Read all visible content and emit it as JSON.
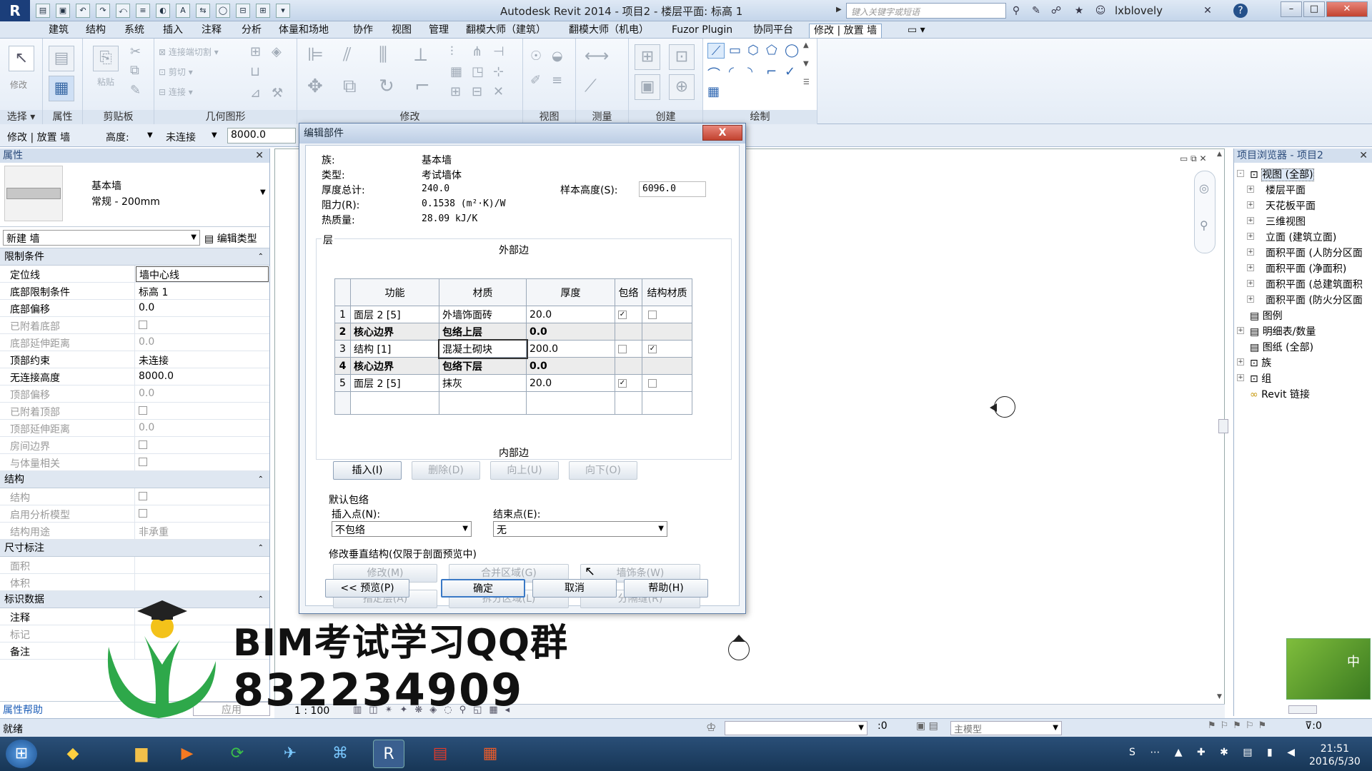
{
  "title": {
    "app": "Autodesk Revit 2014 -    项目2 - 楼层平面: 标高 1",
    "search_placeholder": "键入关键字或短语",
    "user": "lxblovely",
    "help": "?"
  },
  "quick_access": [
    "▤",
    "▣",
    "↶",
    "↷",
    "⤺",
    "≡",
    "◐",
    "A",
    "⇆",
    "◯",
    "⊟",
    "⊞",
    "▾"
  ],
  "menu": [
    "建筑",
    "结构",
    "系统",
    "插入",
    "注释",
    "分析",
    "体量和场地",
    "协作",
    "视图",
    "管理",
    "翻模大师（建筑）",
    "翻模大师（机电）",
    "Fuzor Plugin",
    "协同平台",
    "修改 | 放置 墙",
    "▭ ▾"
  ],
  "ribbon": {
    "groups": [
      "选择 ▾",
      "属性",
      "剪贴板",
      "几何图形",
      "修改",
      "视图",
      "测量",
      "创建",
      "绘制"
    ],
    "modify_label": "修改",
    "paste_label": "粘贴",
    "geometry_items": [
      "连接端切割 ▾",
      "剪切 ▾",
      "连接 ▾"
    ]
  },
  "options_bar": {
    "context": "修改 | 放置 墙",
    "height_label": "高度:",
    "height_mode": "未连接",
    "height_value": "8000.0"
  },
  "properties": {
    "title": "属性",
    "type_name": "基本墙",
    "type_sub": "常规 - 200mm",
    "instance_selector": "新建 墙",
    "edit_type": "编辑类型",
    "sections": [
      {
        "name": "限制条件",
        "rows": [
          {
            "k": "定位线",
            "v": "墙中心线",
            "dis": false
          },
          {
            "k": "底部限制条件",
            "v": "标高 1",
            "dis": false
          },
          {
            "k": "底部偏移",
            "v": "0.0",
            "dis": false
          },
          {
            "k": "已附着底部",
            "v": "",
            "cb": true,
            "dis": true
          },
          {
            "k": "底部延伸距离",
            "v": "0.0",
            "dis": true
          },
          {
            "k": "顶部约束",
            "v": "未连接",
            "dis": false
          },
          {
            "k": "无连接高度",
            "v": "8000.0",
            "dis": false
          },
          {
            "k": "顶部偏移",
            "v": "0.0",
            "dis": true
          },
          {
            "k": "已附着顶部",
            "v": "",
            "cb": true,
            "dis": true
          },
          {
            "k": "顶部延伸距离",
            "v": "0.0",
            "dis": true
          },
          {
            "k": "房间边界",
            "v": "",
            "cb": true,
            "dis": true
          },
          {
            "k": "与体量相关",
            "v": "",
            "cb": true,
            "dis": true
          }
        ]
      },
      {
        "name": "结构",
        "rows": [
          {
            "k": "结构",
            "v": "",
            "cb": true,
            "dis": true
          },
          {
            "k": "启用分析模型",
            "v": "",
            "cb": true,
            "dis": true
          },
          {
            "k": "结构用途",
            "v": "非承重",
            "dis": true
          }
        ]
      },
      {
        "name": "尺寸标注",
        "rows": [
          {
            "k": "面积",
            "v": "",
            "dis": true
          },
          {
            "k": "体积",
            "v": "",
            "dis": true
          }
        ]
      },
      {
        "name": "标识数据",
        "rows": [
          {
            "k": "注释",
            "v": "",
            "dis": false
          },
          {
            "k": "标记",
            "v": "",
            "dis": true
          },
          {
            "k": "备注",
            "v": "",
            "dis": false
          }
        ]
      }
    ],
    "help_link": "属性帮助",
    "apply": "应用"
  },
  "browser": {
    "title": "项目浏览器 - 项目2",
    "items": [
      {
        "label": "视图 (全部)",
        "level": 0,
        "exp": "-"
      },
      {
        "label": "楼层平面",
        "level": 1,
        "exp": "+"
      },
      {
        "label": "天花板平面",
        "level": 1,
        "exp": "+"
      },
      {
        "label": "三维视图",
        "level": 1,
        "exp": "+"
      },
      {
        "label": "立面 (建筑立面)",
        "level": 1,
        "exp": "+"
      },
      {
        "label": "面积平面 (人防分区面",
        "level": 1,
        "exp": "+"
      },
      {
        "label": "面积平面 (净面积)",
        "level": 1,
        "exp": "+"
      },
      {
        "label": "面积平面 (总建筑面积",
        "level": 1,
        "exp": "+"
      },
      {
        "label": "面积平面 (防火分区面",
        "level": 1,
        "exp": "+"
      },
      {
        "label": "图例",
        "level": 0,
        "exp": ""
      },
      {
        "label": "明细表/数量",
        "level": 0,
        "exp": "+"
      },
      {
        "label": "图纸 (全部)",
        "level": 0,
        "exp": ""
      },
      {
        "label": "族",
        "level": 0,
        "exp": "+"
      },
      {
        "label": "组",
        "level": 0,
        "exp": "+"
      },
      {
        "label": "Revit 链接",
        "level": 0,
        "exp": ""
      }
    ]
  },
  "dialog": {
    "title": "编辑部件",
    "close": "X",
    "family_label": "族:",
    "family": "基本墙",
    "type_label": "类型:",
    "type": "考试墙体",
    "thickness_label": "厚度总计:",
    "thickness": "240.0",
    "resistance_label": "阻力(R):",
    "resistance": "0.1538 (m²·K)/W",
    "mass_label": "热质量:",
    "mass": "28.09 kJ/K",
    "sample_height_label": "样本高度(S):",
    "sample_height": "6096.0",
    "layers_label": "层",
    "exterior": "外部边",
    "interior": "内部边",
    "columns": [
      "功能",
      "材质",
      "厚度",
      "包络",
      "结构材质"
    ],
    "rows": [
      {
        "n": "1",
        "fn": "面层 2 [5]",
        "mat": "外墙饰面砖",
        "th": "20.0",
        "wrap": true,
        "sm": false,
        "core": false
      },
      {
        "n": "2",
        "fn": "核心边界",
        "mat": "包络上层",
        "th": "0.0",
        "core": true
      },
      {
        "n": "3",
        "fn": "结构 [1]",
        "mat": "混凝土砌块",
        "th": "200.0",
        "wrap": false,
        "sm": true,
        "core": false
      },
      {
        "n": "4",
        "fn": "核心边界",
        "mat": "包络下层",
        "th": "0.0",
        "core": true
      },
      {
        "n": "5",
        "fn": "面层 2 [5]",
        "mat": "抹灰",
        "th": "20.0",
        "wrap": true,
        "sm": false,
        "core": false
      }
    ],
    "btn_insert": "插入(I)",
    "btn_delete": "删除(D)",
    "btn_up": "向上(U)",
    "btn_down": "向下(O)",
    "default_wrap": "默认包络",
    "insert_point_label": "插入点(N):",
    "insert_point": "不包络",
    "end_point_label": "结束点(E):",
    "end_point": "无",
    "vertical_label": "修改垂直结构(仅限于剖面预览中)",
    "btn_modify": "修改(M)",
    "btn_merge": "合并区域(G)",
    "btn_sweep": "墙饰条(W)",
    "btn_assign": "指定层(A)",
    "btn_split": "拆分区域(L)",
    "btn_reveal": "分隔缝(R)",
    "btn_preview": "<< 预览(P)",
    "btn_ok": "确定",
    "btn_cancel": "取消",
    "btn_help": "帮助(H)"
  },
  "statusbar": {
    "ready": "就绪",
    "scale": "1 : 100",
    "sel_count": ":0",
    "model": "主模型",
    "filter": ":0"
  },
  "taskbar": {
    "time": "21:51",
    "date": "2016/5/30"
  },
  "watermark": {
    "line1": "BIM考试学习QQ群",
    "line2": "832234909"
  }
}
